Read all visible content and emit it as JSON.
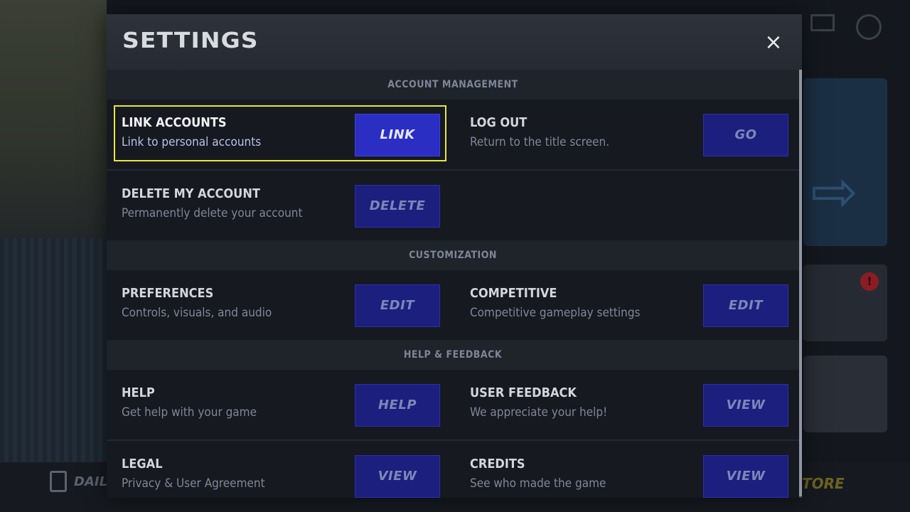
{
  "background": {
    "daily_label": "DAIL",
    "store_label": "TORE"
  },
  "modal": {
    "title": "SETTINGS",
    "close_icon": "×"
  },
  "sections": [
    {
      "header": "ACCOUNT MANAGEMENT",
      "rows": [
        {
          "left": {
            "label": "LINK ACCOUNTS",
            "desc": "Link to personal accounts",
            "button": "LINK"
          },
          "right": {
            "label": "LOG OUT",
            "desc": "Return to the title screen.",
            "button": "GO"
          }
        },
        {
          "left": {
            "label": "DELETE MY ACCOUNT",
            "desc": "Permanently delete your account",
            "button": "DELETE"
          }
        }
      ]
    },
    {
      "header": "CUSTOMIZATION",
      "rows": [
        {
          "left": {
            "label": "PREFERENCES",
            "desc": "Controls, visuals, and audio",
            "button": "EDIT"
          },
          "right": {
            "label": "COMPETITIVE",
            "desc": "Competitive gameplay settings",
            "button": "EDIT"
          }
        }
      ]
    },
    {
      "header": "HELP & FEEDBACK",
      "rows": [
        {
          "left": {
            "label": "HELP",
            "desc": "Get help with your game",
            "button": "HELP"
          },
          "right": {
            "label": "USER FEEDBACK",
            "desc": "We appreciate your help!",
            "button": "VIEW"
          }
        },
        {
          "left": {
            "label": "LEGAL",
            "desc": "Privacy & User Agreement",
            "button": "VIEW"
          },
          "right": {
            "label": "CREDITS",
            "desc": "See who made the game",
            "button": "VIEW"
          }
        }
      ]
    }
  ],
  "colors": {
    "focus_outline": "#e8e63a",
    "button_active": "#2a2ec2",
    "button_idle": "#1d1f7e"
  }
}
